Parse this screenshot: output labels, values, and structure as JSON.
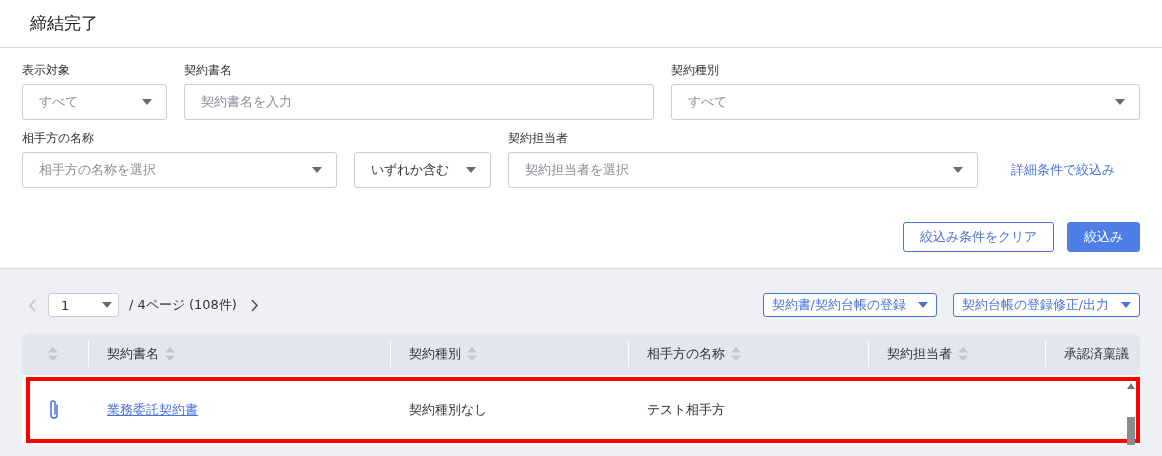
{
  "title": "締結完了",
  "filter_rows": [
    [
      {
        "label": "表示対象",
        "kind": "select",
        "placeholder": "すべて"
      },
      {
        "label": "契約書名",
        "kind": "input",
        "placeholder": "契約書名を入力"
      },
      {
        "label": "契約種別",
        "kind": "select",
        "placeholder": "すべて"
      }
    ],
    [
      {
        "label": "相手方の名称",
        "kind": "select",
        "placeholder": "相手方の名称を選択"
      },
      {
        "kind": "select",
        "value": "いずれか含む"
      },
      {
        "label": "契約担当者",
        "kind": "select",
        "placeholder": "契約担当者を選択"
      },
      {
        "kind": "link",
        "value": "詳細条件で絞込み"
      }
    ]
  ],
  "actions": [
    {
      "label": "絞込み条件をクリア",
      "primary": false
    },
    {
      "label": "絞込み",
      "primary": true
    }
  ],
  "pagination": {
    "page": "1",
    "summary": "/ 4ページ (108件)",
    "prev_disabled": true
  },
  "menus": [
    "契約書/契約台帳の登録",
    "契約台帳の登録修正/出力"
  ],
  "table": {
    "columns": [
      {
        "sortable": true
      },
      {
        "label": "契約書名",
        "sortable": true
      },
      {
        "label": "契約種別",
        "sortable": true
      },
      {
        "label": "相手方の名称",
        "sortable": true
      },
      {
        "label": "契約担当者",
        "sortable": true
      },
      {
        "label": "承認済稟議",
        "sortable": false
      }
    ],
    "rows": [
      {
        "attachment": true,
        "name": "業務委託契約書",
        "type": "契約種別なし",
        "party": "テスト相手方",
        "highlighted": true
      }
    ]
  }
}
